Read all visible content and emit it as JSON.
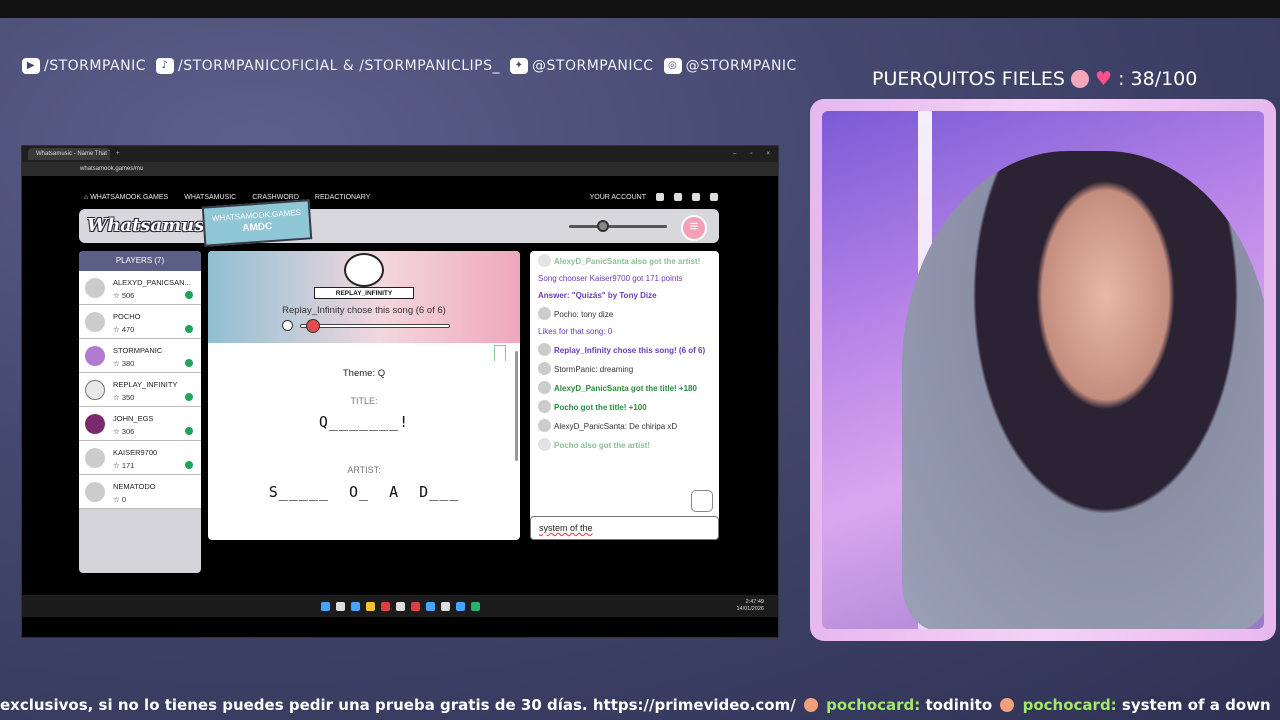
{
  "overlay": {
    "socials": [
      {
        "icon": "youtube-icon",
        "text": "/STORMPANIC"
      },
      {
        "icon": "tiktok-icon",
        "text": "/STORMPANICOFICIAL & /STORMPANICLIPS_"
      },
      {
        "icon": "twitter-icon",
        "text": "@STORMPANICC"
      },
      {
        "icon": "instagram-icon",
        "text": "@STORMPANIC"
      }
    ],
    "follower_label": "PUERQUITOS FIELES",
    "follower_count": ": 38/100",
    "ticker": {
      "text1": "exclusivos, si no lo tienes puedes pedir una prueba gratis de 30 días. https://primevideo.com/",
      "nick1": "pochocard:",
      "msg1": "todinito",
      "nick2": "pochocard:",
      "msg2": "system of a down"
    }
  },
  "browser": {
    "tab_title": "Whatsamusic - Name That Tu...",
    "url": "whatsamook.games/mu",
    "nav": [
      "WHATSAMOOK.GAMES",
      "WHATSAMUSIC",
      "CRASHWORD",
      "REDACTIONARY"
    ],
    "account": "YOUR ACCOUNT",
    "taskbar_time": "2:47:49",
    "taskbar_date": "14/01/2026",
    "taskbar_lang": "ESP\nES"
  },
  "game": {
    "logo": "Whatsamusic",
    "badge_top": "WHATSAMOOK.GAMES",
    "badge_code": "AMDC",
    "volume_level": 0.35,
    "players_header": "PLAYERS (7)",
    "players": [
      {
        "name": "ALEXYD_PANICSAN...",
        "score": "506",
        "checked": true,
        "avatar": "default"
      },
      {
        "name": "POCHO",
        "score": "470",
        "checked": true,
        "avatar": "default"
      },
      {
        "name": "STORMPANIC",
        "score": "380",
        "checked": true,
        "avatar": "photo"
      },
      {
        "name": "REPLAY_INFINITY",
        "score": "350",
        "checked": true,
        "avatar": "troll"
      },
      {
        "name": "JOHN_EGS",
        "score": "306",
        "checked": true,
        "avatar": "photo-dark"
      },
      {
        "name": "KAISER9700",
        "score": "171",
        "checked": true,
        "avatar": "default"
      },
      {
        "name": "NEMATODO",
        "score": "0",
        "checked": false,
        "avatar": "default"
      }
    ],
    "chooser_tag": "REPLAY_INFINITY",
    "chooser_text": "Replay_Infinity chose this song (6 of 6)",
    "progress": 0.05,
    "theme": "Theme: Q",
    "title_label": "TITLE:",
    "title_blanks": "Q_______!",
    "artist_label": "ARTIST:",
    "artist_blanks": "S_____  O_  A  D___"
  },
  "chat": {
    "messages": [
      {
        "text": "AlexyD_PanicSanta also got the artist!",
        "style": "green dim",
        "avatar": true
      },
      {
        "text": "Song chooser Kaiser9700 got 171 points",
        "style": "purple",
        "avatar": false
      },
      {
        "text": "Answer: \"Quizás\" by Tony Dize",
        "style": "purple bold",
        "avatar": false
      },
      {
        "text": "Pocho: tony dize",
        "style": "",
        "avatar": true
      },
      {
        "text": "Likes for that song: 0",
        "style": "purple",
        "avatar": false
      },
      {
        "text": "Replay_Infinity chose this song! (6 of 6)",
        "style": "purple bold",
        "avatar": true
      },
      {
        "text": "StormPanic: dreaming",
        "style": "",
        "avatar": true
      },
      {
        "text": "AlexyD_PanicSanta got the title! +180",
        "style": "green",
        "avatar": true
      },
      {
        "text": "Pocho got the title! +100",
        "style": "green",
        "avatar": true
      },
      {
        "text": "AlexyD_PanicSanta: De chiripa xD",
        "style": "",
        "avatar": true
      },
      {
        "text": "Pocho also got the artist!",
        "style": "green dim",
        "avatar": true
      }
    ],
    "input_value": "system of the"
  }
}
